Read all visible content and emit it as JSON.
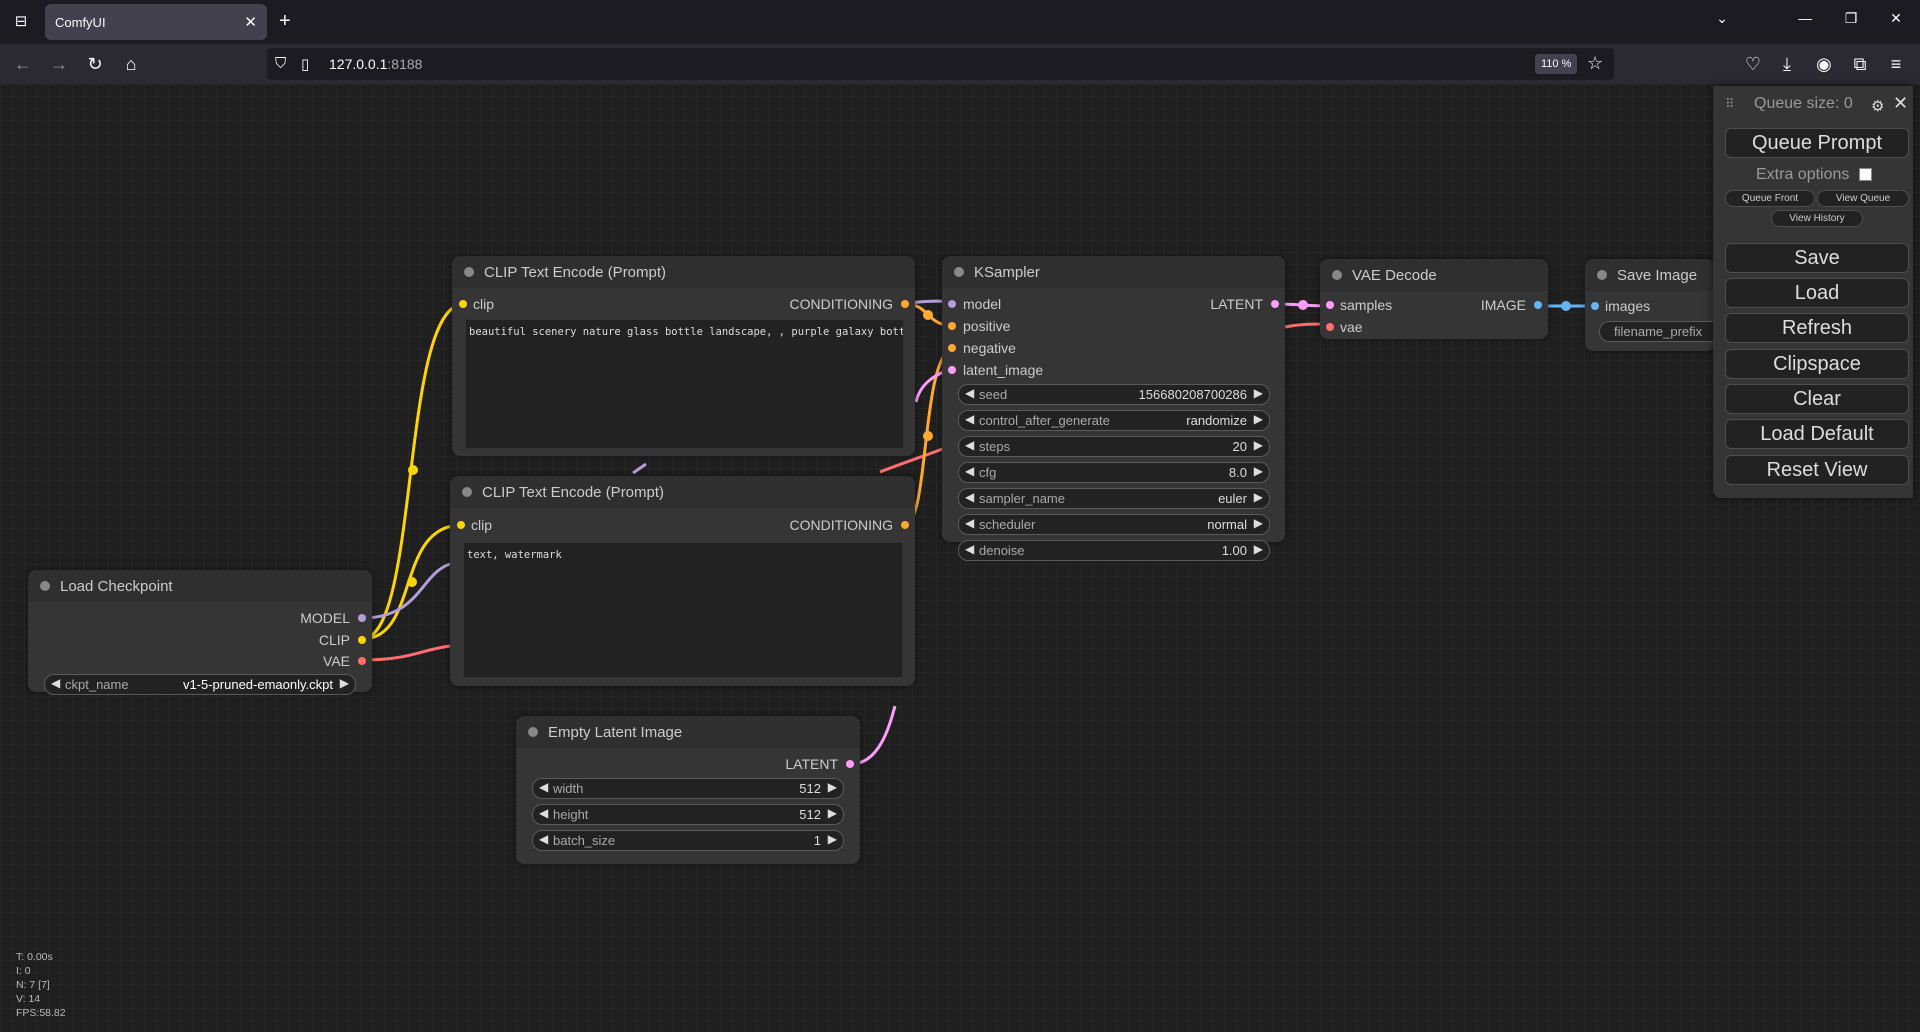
{
  "browser": {
    "tab_title": "ComfyUI",
    "url_host": "127.0.0.1",
    "url_port": ":8188",
    "zoom": "110 %"
  },
  "menu": {
    "queue_size": "Queue size: 0",
    "queue_prompt": "Queue Prompt",
    "extra_options": "Extra options",
    "extra_options_checked": false,
    "queue_front": "Queue Front",
    "view_queue": "View Queue",
    "view_history": "View History",
    "buttons": [
      "Save",
      "Load",
      "Refresh",
      "Clipspace",
      "Clear",
      "Load Default",
      "Reset View"
    ]
  },
  "nodes": {
    "clip1": {
      "title": "CLIP Text Encode (Prompt)",
      "input_clip": "clip",
      "output": "CONDITIONING",
      "text": "beautiful scenery nature glass bottle landscape, , purple galaxy bottle,"
    },
    "clip2": {
      "title": "CLIP Text Encode (Prompt)",
      "input_clip": "clip",
      "output": "CONDITIONING",
      "text": "text, watermark"
    },
    "ksampler": {
      "title": "KSampler",
      "inputs": [
        "model",
        "positive",
        "negative",
        "latent_image"
      ],
      "output": "LATENT",
      "widgets": [
        {
          "name": "seed",
          "value": "156680208700286"
        },
        {
          "name": "control_after_generate",
          "value": "randomize"
        },
        {
          "name": "steps",
          "value": "20"
        },
        {
          "name": "cfg",
          "value": "8.0"
        },
        {
          "name": "sampler_name",
          "value": "euler"
        },
        {
          "name": "scheduler",
          "value": "normal"
        },
        {
          "name": "denoise",
          "value": "1.00"
        }
      ]
    },
    "vae_decode": {
      "title": "VAE Decode",
      "inputs": [
        "samples",
        "vae"
      ],
      "output": "IMAGE"
    },
    "save_image": {
      "title": "Save Image",
      "input": "images",
      "widget": "filename_prefix"
    },
    "load_checkpoint": {
      "title": "Load Checkpoint",
      "outputs": [
        "MODEL",
        "CLIP",
        "VAE"
      ],
      "widget": {
        "name": "ckpt_name",
        "value": "v1-5-pruned-emaonly.ckpt"
      }
    },
    "empty_latent": {
      "title": "Empty Latent Image",
      "output": "LATENT",
      "widgets": [
        {
          "name": "width",
          "value": "512"
        },
        {
          "name": "height",
          "value": "512"
        },
        {
          "name": "batch_size",
          "value": "1"
        }
      ]
    }
  },
  "stats": [
    "T: 0.00s",
    "I: 0",
    "N: 7 [7]",
    "V: 14",
    "FPS:58.82"
  ],
  "colors": {
    "clip": "#ffd500",
    "model": "#b39ddb",
    "conditioning": "#ffa931",
    "latent": "#ff9cf9",
    "vae": "#ff6e6e",
    "image": "#64b5f6"
  }
}
